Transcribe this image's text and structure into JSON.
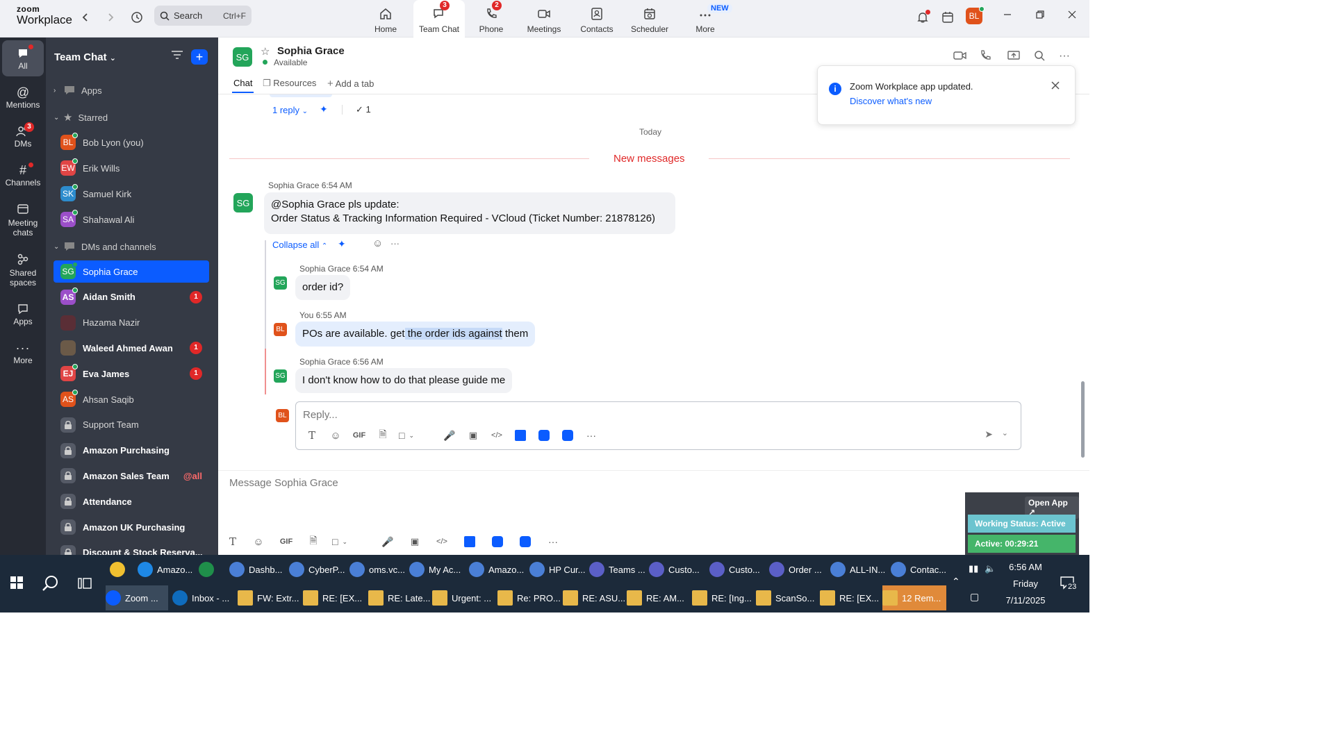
{
  "app": {
    "logo_line1": "zoom",
    "logo_line2": "Workplace"
  },
  "search": {
    "label": "Search",
    "shortcut": "Ctrl+F"
  },
  "nav": [
    {
      "label": "Home",
      "badge": ""
    },
    {
      "label": "Team Chat",
      "badge": "3"
    },
    {
      "label": "Phone",
      "badge": "2"
    },
    {
      "label": "Meetings",
      "badge": ""
    },
    {
      "label": "Contacts",
      "badge": ""
    },
    {
      "label": "Scheduler",
      "badge": ""
    },
    {
      "label": "More",
      "badge": "NEW"
    }
  ],
  "user": {
    "initials": "BL",
    "color": "#e0521b"
  },
  "rail": [
    {
      "label": "All"
    },
    {
      "label": "Mentions"
    },
    {
      "label": "DMs",
      "badge": "3"
    },
    {
      "label": "Channels"
    },
    {
      "label": "Meeting chats"
    },
    {
      "label": "Shared spaces"
    },
    {
      "label": "Apps"
    },
    {
      "label": "More"
    }
  ],
  "sidebar": {
    "title": "Team Chat",
    "sections": {
      "apps": "Apps",
      "starred": "Starred",
      "dms": "DMs and channels"
    },
    "starred": [
      {
        "initials": "BL",
        "name": "Bob Lyon (you)",
        "color": "#e0521b"
      },
      {
        "initials": "EW",
        "name": "Erik Wills",
        "color": "#e04545"
      },
      {
        "initials": "SK",
        "name": "Samuel Kirk",
        "color": "#2d8ccd"
      },
      {
        "initials": "SA",
        "name": "Shahawal Ali",
        "color": "#9b4fc9"
      }
    ],
    "chats": [
      {
        "initials": "SG",
        "name": "Sophia Grace",
        "color": "#23a55a",
        "count": "",
        "at": ""
      },
      {
        "initials": "AS",
        "name": "Aidan Smith",
        "color": "#9b4fc9",
        "count": "1",
        "at": ""
      },
      {
        "initials": "",
        "name": "Hazama Nazir",
        "color": "#5a2e36",
        "count": "",
        "at": ""
      },
      {
        "initials": "",
        "name": "Waleed Ahmed Awan",
        "color": "#6b5a48",
        "count": "1",
        "at": ""
      },
      {
        "initials": "EJ",
        "name": "Eva James",
        "color": "#e04545",
        "count": "1",
        "at": ""
      },
      {
        "initials": "AS",
        "name": "Ahsan Saqib",
        "color": "#e0521b",
        "count": "",
        "at": ""
      },
      {
        "initials": "",
        "name": "Support Team",
        "color": "",
        "count": "",
        "at": ""
      },
      {
        "initials": "",
        "name": "Amazon Purchasing",
        "color": "",
        "count": "",
        "at": ""
      },
      {
        "initials": "",
        "name": "Amazon Sales Team",
        "color": "",
        "count": "",
        "at": "@all"
      },
      {
        "initials": "",
        "name": "Attendance",
        "color": "",
        "count": "",
        "at": ""
      },
      {
        "initials": "",
        "name": "Amazon UK Purchasing",
        "color": "",
        "count": "",
        "at": ""
      },
      {
        "initials": "",
        "name": "Discount & Stock Reserva...",
        "color": "",
        "count": "",
        "at": ""
      }
    ]
  },
  "chat": {
    "initials": "SG",
    "name": "Sophia Grace",
    "status": "Available",
    "tabs": [
      "Chat",
      "Resources",
      "Add a tab"
    ],
    "reply_count": "1 reply",
    "check_count": "1",
    "today": "Today",
    "new_messages": "New messages",
    "main_message": {
      "sender": "Sophia Grace",
      "time": "6:54 AM",
      "line1": "@Sophia Grace pls update:",
      "line2": "Order Status & Tracking Information Required - VCloud (Ticket Number: 21878126)"
    },
    "collapse": "Collapse all",
    "replies": [
      {
        "initials": "SG",
        "sender": "Sophia Grace",
        "time": "6:54 AM",
        "text": "order id?"
      },
      {
        "initials": "BL",
        "sender": "You",
        "time": "6:55 AM",
        "text_pre": "POs are available. get",
        "text_hl": " the order ids against",
        "text_post": " them"
      },
      {
        "initials": "SG",
        "sender": "Sophia Grace",
        "time": "6:56 AM",
        "text": "I don't know how to do that please guide me"
      }
    ],
    "reply_placeholder": "Reply...",
    "compose_placeholder": "Message Sophia Grace"
  },
  "toast": {
    "title": "Zoom Workplace app updated.",
    "link": "Discover what's new"
  },
  "widget": {
    "open_app": "Open App ↗",
    "status": "Working Status: Active",
    "active": "Active: 00:29:21"
  },
  "taskbar": {
    "row1": [
      {
        "label": "",
        "color": "#f0c030"
      },
      {
        "label": "Amazo...",
        "color": "#1e88e5"
      },
      {
        "label": "",
        "color": "#1f8f4a"
      },
      {
        "label": "Dashb...",
        "color": "#4a7fd6"
      },
      {
        "label": "CyberP...",
        "color": "#4a7fd6"
      },
      {
        "label": "oms.vc...",
        "color": "#4a7fd6"
      },
      {
        "label": "My Ac...",
        "color": "#4a7fd6"
      },
      {
        "label": "Amazo...",
        "color": "#4a7fd6"
      },
      {
        "label": "HP Cur...",
        "color": "#4a7fd6"
      },
      {
        "label": "Teams ...",
        "color": "#5b5fc7"
      },
      {
        "label": "Custo...",
        "color": "#5b5fc7"
      },
      {
        "label": "Custo...",
        "color": "#5b5fc7"
      },
      {
        "label": "Order ...",
        "color": "#5b5fc7"
      },
      {
        "label": "ALL-IN...",
        "color": "#4a7fd6"
      },
      {
        "label": "Contac...",
        "color": "#4a7fd6"
      }
    ],
    "row2": [
      {
        "label": "Zoom ...",
        "color": "#0b5cff"
      },
      {
        "label": "Inbox - ...",
        "color": "#0f6cbd"
      },
      {
        "label": "FW: Extr...",
        "color": "#e8b84a"
      },
      {
        "label": "RE: [EX...",
        "color": "#e8b84a"
      },
      {
        "label": "RE: Late...",
        "color": "#e8b84a"
      },
      {
        "label": "Urgent: ...",
        "color": "#e8b84a"
      },
      {
        "label": "Re: PRO...",
        "color": "#e8b84a"
      },
      {
        "label": "RE: ASU...",
        "color": "#e8b84a"
      },
      {
        "label": "RE: AM...",
        "color": "#e8b84a"
      },
      {
        "label": "RE: [Ing...",
        "color": "#e8b84a"
      },
      {
        "label": "ScanSo...",
        "color": "#e8b84a"
      },
      {
        "label": "RE: [EX...",
        "color": "#e8b84a"
      },
      {
        "label": "12 Rem...",
        "color": "#e8b84a"
      }
    ],
    "time": "6:56 AM",
    "day": "Friday",
    "date": "7/11/2025",
    "notif_count": "23"
  }
}
